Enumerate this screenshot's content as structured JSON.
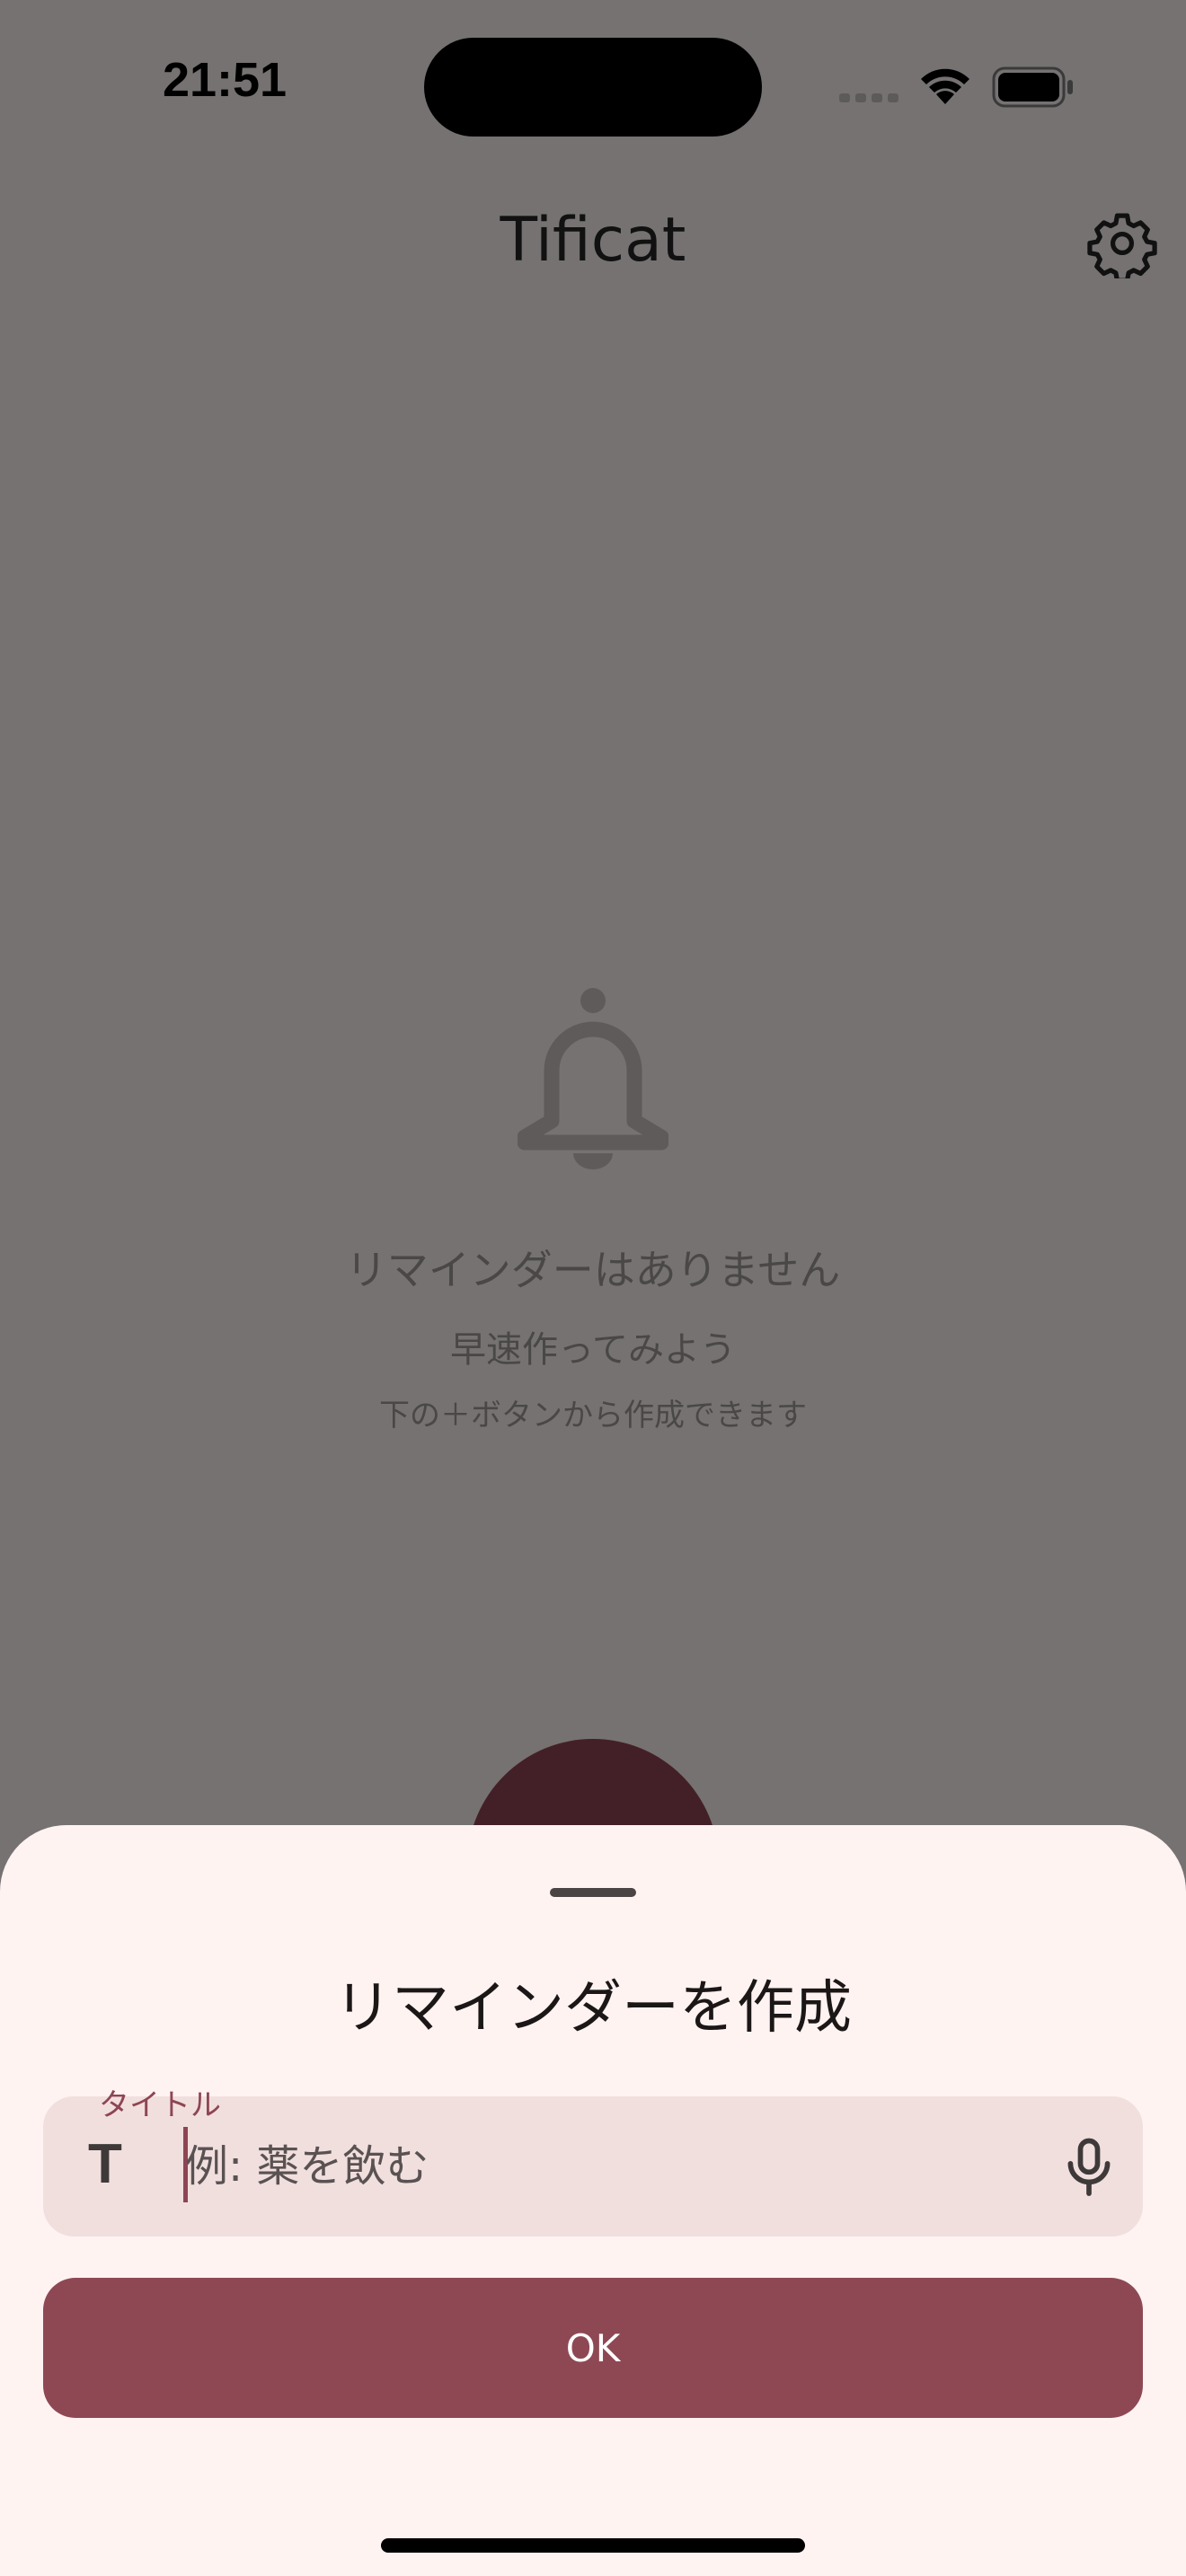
{
  "status_bar": {
    "time": "21:51",
    "wifi_icon": "wifi-icon",
    "battery_icon": "battery-icon"
  },
  "header": {
    "title": "Tificat",
    "settings_icon": "gear-icon"
  },
  "empty_state": {
    "icon": "bell-icon",
    "title": "リマインダーはありません",
    "subtitle": "早速作ってみよう",
    "hint": "下の＋ボタンから作成できます"
  },
  "sheet": {
    "title": "リマインダーを作成",
    "field_label": "タイトル",
    "field_icon": "T",
    "field_placeholder": "例: 薬を飲む",
    "field_value": "",
    "mic_icon": "microphone-icon",
    "ok_label": "OK"
  },
  "colors": {
    "accent": "#8e4854",
    "sheet_background": "#fff3f2",
    "field_background": "#f1dfde",
    "scrim": "#767272"
  }
}
